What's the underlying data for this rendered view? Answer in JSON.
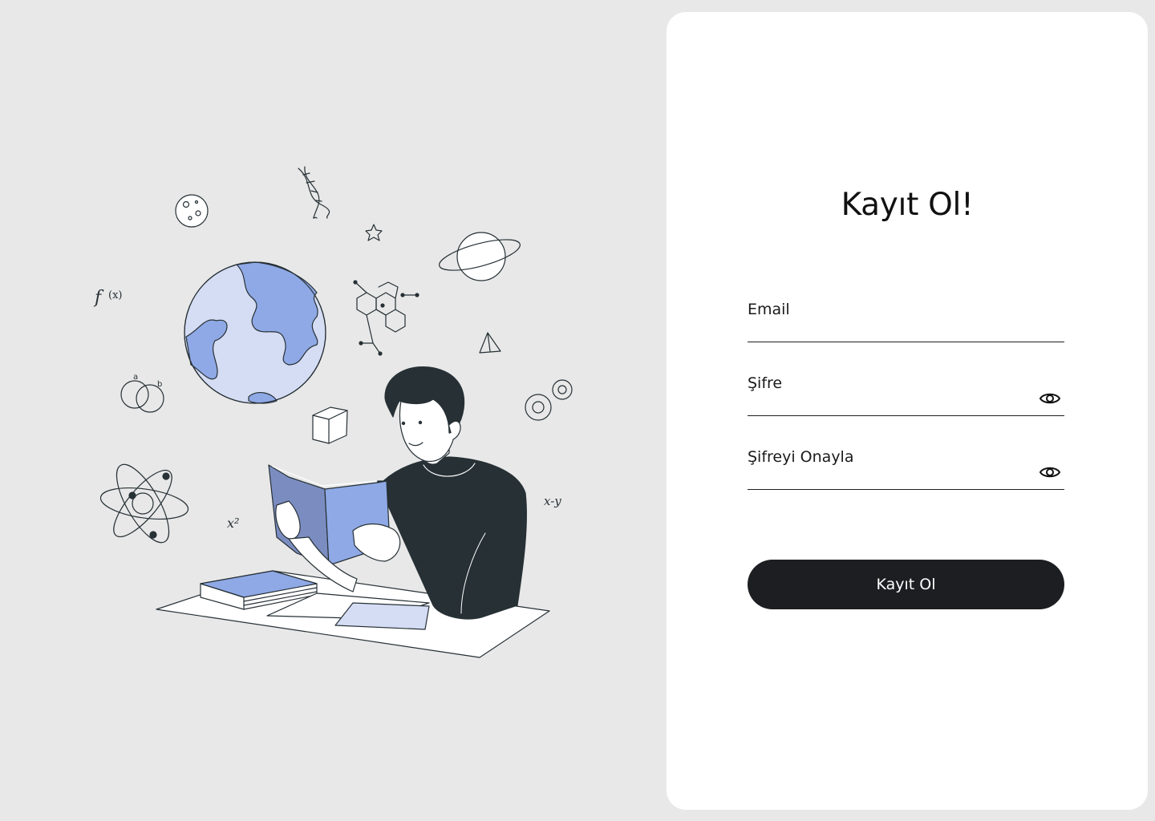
{
  "page": {
    "background": "#e8e8e8",
    "card_background": "#ffffff"
  },
  "illustration": {
    "subject": "person-reading-book-icon",
    "math_texts": {
      "fx": "f(x)",
      "x2": "x²",
      "xy": "x-y",
      "a": "a",
      "b": "b"
    },
    "accent_color": "#8fa9e6",
    "accent_light": "#d5ddf4",
    "ink_color": "#263035"
  },
  "form": {
    "title": "Kayıt Ol!",
    "email": {
      "label": "Email",
      "value": ""
    },
    "password": {
      "label": "Şifre",
      "value": "",
      "toggle_icon": "eye-icon"
    },
    "confirm_password": {
      "label": "Şifreyi Onayla",
      "value": "",
      "toggle_icon": "eye-icon"
    },
    "submit_label": "Kayıt Ol",
    "submit_color": "#1d1e21"
  }
}
